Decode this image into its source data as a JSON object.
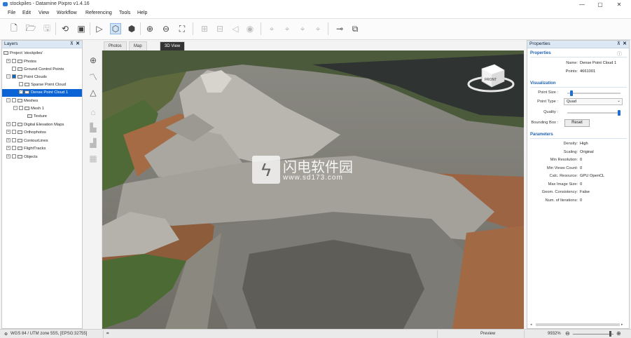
{
  "window": {
    "title": "stockpiles - Datamine Pixpro v1.4.16",
    "controls": [
      "—",
      "▢",
      "✕"
    ]
  },
  "menu": [
    "File",
    "Edit",
    "View",
    "Workflow",
    "Referencing",
    "Tools",
    "Help"
  ],
  "layers": {
    "title": "Layers",
    "items": [
      {
        "label": "Project 'stockpiles'",
        "level": 0
      },
      {
        "label": "Photos",
        "level": 1
      },
      {
        "label": "Ground Control Points",
        "level": 1
      },
      {
        "label": "Point Clouds",
        "level": 1
      },
      {
        "label": "Sparse Point Cloud",
        "level": 2
      },
      {
        "label": "Dense Point Cloud 1",
        "level": 2
      },
      {
        "label": "Meshes",
        "level": 1
      },
      {
        "label": "Mesh 1",
        "level": 2
      },
      {
        "label": "Texture",
        "level": 3
      },
      {
        "label": "Digital Elevation Maps",
        "level": 1
      },
      {
        "label": "Orthophotos",
        "level": 1
      },
      {
        "label": "ContourLines",
        "level": 1
      },
      {
        "label": "FlightTracks",
        "level": 1
      },
      {
        "label": "Objects",
        "level": 1
      }
    ]
  },
  "view": {
    "tabs": [
      "Photos",
      "Map",
      "3D View"
    ],
    "active_tab": "3D View",
    "cube_label": "FRONT",
    "watermark": {
      "cn": "闪电软件园",
      "url": "www.sd173.com"
    }
  },
  "properties": {
    "title": "Properties",
    "sections": {
      "properties": "Properties",
      "visualization": "Visualization",
      "parameters": "Parameters"
    },
    "props": [
      {
        "label": "Name:",
        "value": "Dense Point Cloud 1"
      },
      {
        "label": "Points:",
        "value": "4661001"
      }
    ],
    "visual": {
      "point_size_label": "Point Size :",
      "point_size_level": 0.05,
      "point_type_label": "Point Type :",
      "point_type_value": "Quad",
      "quality_label": "Quality :",
      "quality_level": 1.0,
      "bbox_label": "Bounding Box :",
      "reset_label": "Reset"
    },
    "params": [
      {
        "label": "Density:",
        "value": "High"
      },
      {
        "label": "Scaling:",
        "value": "Original"
      },
      {
        "label": "Min Resolution:",
        "value": "0"
      },
      {
        "label": "Min Views Count:",
        "value": "0"
      },
      {
        "label": "Calc. Resource:",
        "value": "GPU OpenCL"
      },
      {
        "label": "Max Image Size:",
        "value": "0"
      },
      {
        "label": "Geom. Consistency:",
        "value": "False"
      },
      {
        "label": "Num. of Iterations:",
        "value": "0"
      }
    ]
  },
  "status": {
    "crs": "WGS 84 / UTM zone 55S, [EPSG:32755]",
    "mode": "Preview",
    "zoom": "9932%"
  }
}
